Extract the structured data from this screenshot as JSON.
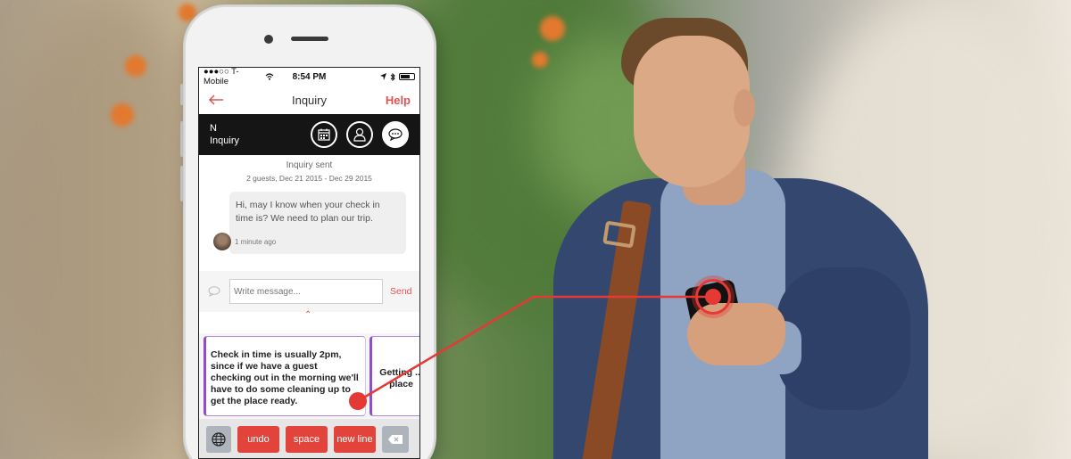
{
  "status_bar": {
    "carrier": "●●●○○ T-Mobile",
    "time": "8:54 PM"
  },
  "nav": {
    "back_icon": "arrow-left-icon",
    "title": "Inquiry",
    "help": "Help"
  },
  "header": {
    "name": "N",
    "subtitle": "Inquiry",
    "buttons": [
      "calendar-icon",
      "profile-icon",
      "message-icon"
    ]
  },
  "thread": {
    "status": "Inquiry sent",
    "details": "2 guests, Dec 21 2015 - Dec 29 2015",
    "message": "Hi, may I know when your check in time is? We need to plan our trip.",
    "timestamp": "1 minute ago"
  },
  "compose": {
    "placeholder": "Write message...",
    "send": "Send"
  },
  "suggestions": [
    "Check in time is usually 2pm, since if we have a guest checking out in the morning we'll have to do some cleaning up to get the place ready.",
    "Getting ... place"
  ],
  "keyboard": {
    "undo": "undo",
    "space": "space",
    "newline": "new line"
  },
  "colors": {
    "accent": "#e05353",
    "key_red": "#e2433b",
    "card_border": "#8e4fc6"
  }
}
